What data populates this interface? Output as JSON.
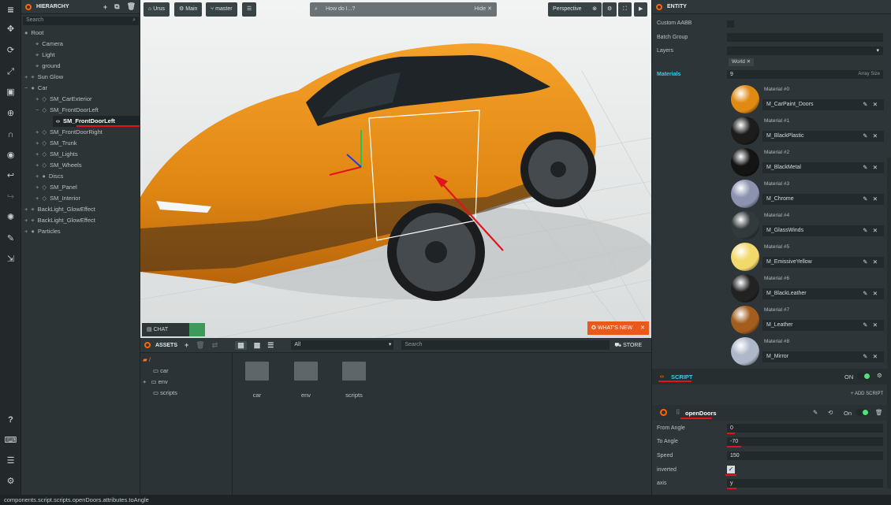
{
  "toolbar": {
    "logo": "≡"
  },
  "hierarchy": {
    "title": "HIERARCHY",
    "search_placeholder": "Search",
    "items": [
      {
        "label": "Root"
      },
      {
        "label": "Camera"
      },
      {
        "label": "Light"
      },
      {
        "label": "ground"
      },
      {
        "label": "Sun Glow"
      },
      {
        "label": "Car"
      },
      {
        "label": "SM_CarExterior"
      },
      {
        "label": "SM_FrontDoorLeft"
      },
      {
        "label": "SM_FrontDoorLeft"
      },
      {
        "label": "SM_FrontDoorRight"
      },
      {
        "label": "SM_Trunk"
      },
      {
        "label": "SM_Lights"
      },
      {
        "label": "SM_Wheels"
      },
      {
        "label": "Discs"
      },
      {
        "label": "SM_Panel"
      },
      {
        "label": "SM_Interior"
      },
      {
        "label": "BackLight_GlowEffect"
      },
      {
        "label": "BackLight_GlowEffect"
      },
      {
        "label": "Particles"
      }
    ]
  },
  "viewport": {
    "project": "Urus",
    "scene": "Main",
    "branch": "master",
    "search_placeholder": "How do I...?",
    "hide": "Hide",
    "camera": "Perspective",
    "chat": "CHAT",
    "whats_new": "WHAT'S NEW"
  },
  "assets": {
    "title": "ASSETS",
    "filter": "All",
    "search_placeholder": "Search",
    "store": "STORE",
    "tree": {
      "root": "/",
      "folders": [
        "car",
        "env",
        "scripts"
      ]
    },
    "grid": [
      "car",
      "env",
      "scripts"
    ]
  },
  "entity": {
    "title": "ENTITY",
    "custom_aabb": "Custom AABB",
    "batch_group": "Batch Group",
    "layers": "Layers",
    "layer_tag": "World",
    "materials_label": "Materials",
    "materials_count": "9",
    "array_size": "Array Size",
    "materials": [
      {
        "label": "Material #0",
        "name": "M_CarPaint_Doors",
        "color": "#e08a14"
      },
      {
        "label": "Material #1",
        "name": "M_BlackPlastic",
        "color": "#1c1c1c"
      },
      {
        "label": "Material #2",
        "name": "M_BlackMetal",
        "color": "#141414"
      },
      {
        "label": "Material #3",
        "name": "M_Chrome",
        "color": "#8b93b0"
      },
      {
        "label": "Material #4",
        "name": "M_GlassWinds",
        "color": "#333a3c"
      },
      {
        "label": "Material #5",
        "name": "M_EmissiveYellow",
        "color": "#f3d96c"
      },
      {
        "label": "Material #6",
        "name": "M_BlackLeather",
        "color": "#222222"
      },
      {
        "label": "Material #7",
        "name": "M_Leather",
        "color": "#a35e1e"
      },
      {
        "label": "Material #8",
        "name": "M_Mirror",
        "color": "#aeb8c9"
      }
    ],
    "script": {
      "title": "SCRIPT",
      "on": "ON",
      "add_script": "+ ADD SCRIPT",
      "script_name": "openDoors",
      "script_on": "On",
      "attrs": [
        {
          "label": "From Angle",
          "value": "0"
        },
        {
          "label": "To Angle",
          "value": "-70"
        },
        {
          "label": "Speed",
          "value": "150"
        },
        {
          "label": "inverted",
          "value": ""
        },
        {
          "label": "axis",
          "value": "y"
        }
      ]
    }
  },
  "status": "components.script.scripts.openDoors.attributes.toAngle"
}
